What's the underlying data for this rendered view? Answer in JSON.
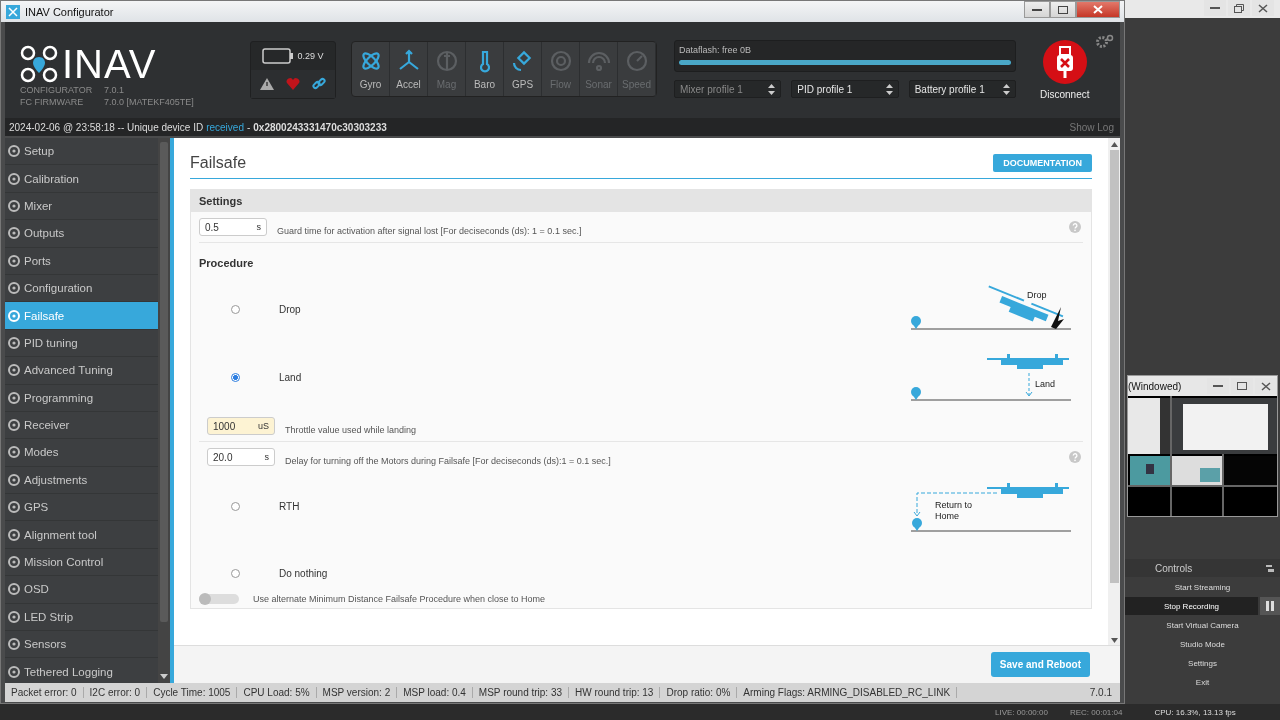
{
  "window": {
    "title": "INAV Configurator"
  },
  "header": {
    "logo": "INAV",
    "versions": [
      {
        "label": "CONFIGURATOR",
        "value": "7.0.1"
      },
      {
        "label": "FC FIRMWARE",
        "value": "7.0.0 [MATEKF405TE]"
      }
    ],
    "battery": {
      "voltage": "0.29 V"
    },
    "sensors": [
      {
        "label": "Gyro",
        "active": true
      },
      {
        "label": "Accel",
        "active": true
      },
      {
        "label": "Mag",
        "active": false
      },
      {
        "label": "Baro",
        "active": true
      },
      {
        "label": "GPS",
        "active": true
      },
      {
        "label": "Flow",
        "active": false
      },
      {
        "label": "Sonar",
        "active": false
      },
      {
        "label": "Speed",
        "active": false
      }
    ],
    "dataflash": {
      "label": "Dataflash: free 0B",
      "level": 1.0
    },
    "profiles": [
      {
        "label": "Mixer profile 1",
        "disabled": true
      },
      {
        "label": "PID profile 1",
        "disabled": false
      },
      {
        "label": "Battery profile 1",
        "disabled": false
      }
    ],
    "disconnect": "Disconnect"
  },
  "log": {
    "text": "2024-02-06 @ 23:58:18 -- Unique device ID",
    "status": "received",
    "separator": "-",
    "device_id": "0x2800243331470c30303233",
    "show_log": "Show Log"
  },
  "sidebar": {
    "items": [
      {
        "label": "Setup",
        "selected": false
      },
      {
        "label": "Calibration",
        "selected": false
      },
      {
        "label": "Mixer",
        "selected": false
      },
      {
        "label": "Outputs",
        "selected": false
      },
      {
        "label": "Ports",
        "selected": false
      },
      {
        "label": "Configuration",
        "selected": false
      },
      {
        "label": "Failsafe",
        "selected": true
      },
      {
        "label": "PID tuning",
        "selected": false
      },
      {
        "label": "Advanced Tuning",
        "selected": false
      },
      {
        "label": "Programming",
        "selected": false
      },
      {
        "label": "Receiver",
        "selected": false
      },
      {
        "label": "Modes",
        "selected": false
      },
      {
        "label": "Adjustments",
        "selected": false
      },
      {
        "label": "GPS",
        "selected": false
      },
      {
        "label": "Alignment tool",
        "selected": false
      },
      {
        "label": "Mission Control",
        "selected": false
      },
      {
        "label": "OSD",
        "selected": false
      },
      {
        "label": "LED Strip",
        "selected": false
      },
      {
        "label": "Sensors",
        "selected": false
      },
      {
        "label": "Tethered Logging",
        "selected": false
      }
    ]
  },
  "page": {
    "title": "Failsafe",
    "documentation": "DOCUMENTATION",
    "settings": {
      "heading": "Settings",
      "guard": {
        "value": "0.5",
        "unit": "s",
        "description": "Guard time for activation after signal lost [For deciseconds (ds): 1 = 0.1 sec.]",
        "highlighted": false,
        "help": true
      },
      "procedure_heading": "Procedure",
      "procedures": [
        {
          "label": "Drop",
          "selected": false,
          "kind": "drop",
          "caption": "Drop"
        },
        {
          "label": "Land",
          "selected": true,
          "kind": "land",
          "caption": "Land",
          "fields": [
            {
              "value": "1000",
              "unit": "uS",
              "description": "Throttle value used while landing",
              "highlighted": true,
              "help": false
            },
            {
              "value": "20.0",
              "unit": "s",
              "description": "Delay for turning off the Motors during Failsafe [For deciseconds (ds):1 = 0.1 sec.]",
              "highlighted": false,
              "help": true
            }
          ]
        },
        {
          "label": "RTH",
          "selected": false,
          "kind": "rth",
          "caption": "Return to Home"
        },
        {
          "label": "Do nothing",
          "selected": false,
          "kind": "none"
        }
      ],
      "toggle": {
        "label": "Use alternate Minimum Distance Failsafe Procedure when close to Home",
        "on": false
      }
    },
    "save": "Save and Reboot"
  },
  "status_bar": {
    "items": [
      "Packet error: 0",
      "I2C error: 0",
      "Cycle Time: 1005",
      "CPU Load: 5%",
      "MSP version: 2",
      "MSP load: 0.4",
      "MSP round trip: 33",
      "HW round trip: 13",
      "Drop ratio: 0%",
      "Arming Flags: ARMING_DISABLED_RC_LINK"
    ],
    "version": "7.0.1"
  },
  "obs": {
    "window_title": "(Windowed)",
    "controls_title": "Controls",
    "buttons": [
      {
        "label": "Start Streaming",
        "active": false
      },
      {
        "label": "Stop Recording",
        "active": true
      },
      {
        "label": "Start Virtual Camera",
        "active": false
      },
      {
        "label": "Studio Mode",
        "active": false
      },
      {
        "label": "Settings",
        "active": false
      },
      {
        "label": "Exit",
        "active": false
      }
    ],
    "stats": [
      "LIVE: 00:00:00",
      "REC: 00:01:04",
      "CPU: 16.3%, 13.13 fps"
    ]
  }
}
